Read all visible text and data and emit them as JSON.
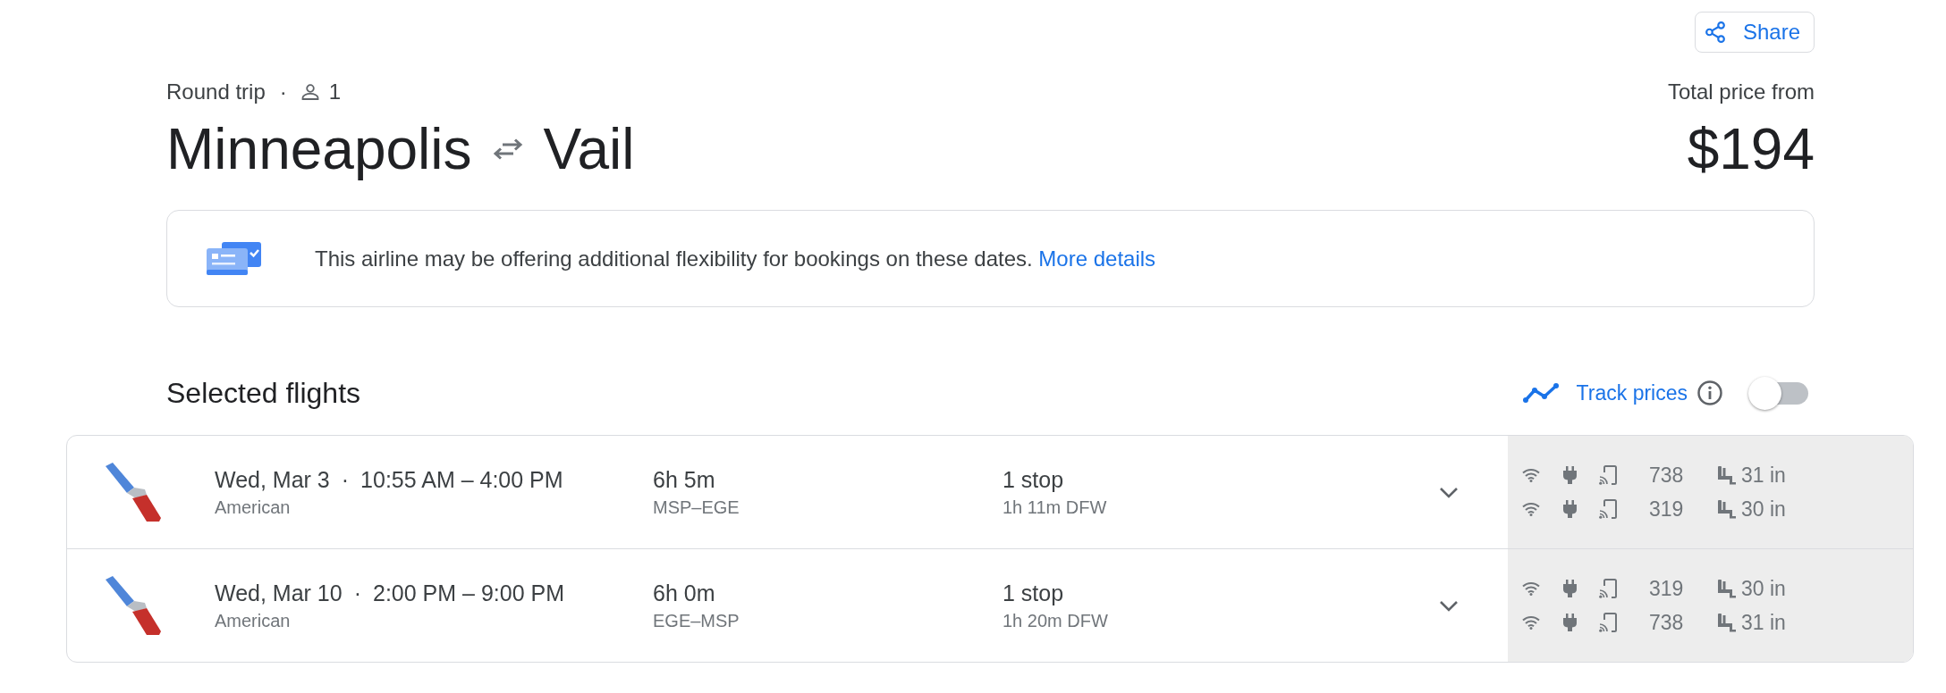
{
  "share": {
    "label": "Share"
  },
  "trip": {
    "type": "Round trip",
    "separator": "·",
    "passengers": "1",
    "origin": "Minneapolis",
    "destination": "Vail"
  },
  "price": {
    "label": "Total price from",
    "amount": "$194"
  },
  "notice": {
    "text": "This airline may be offering additional flexibility for bookings on these dates.",
    "link": "More details"
  },
  "selected_flights": {
    "title": "Selected flights",
    "track_prices": {
      "label": "Track prices",
      "on": false
    }
  },
  "flights": [
    {
      "date": "Wed, Mar 3",
      "separator": "·",
      "times": "10:55 AM – 4:00 PM",
      "airline": "American",
      "duration": "6h 5m",
      "route": "MSP–EGE",
      "stops": "1 stop",
      "layover": "1h 11m DFW",
      "expanded": false,
      "legs": [
        {
          "aircraft": "738",
          "legroom": "31 in"
        },
        {
          "aircraft": "319",
          "legroom": "30 in"
        }
      ]
    },
    {
      "date": "Wed, Mar 10",
      "separator": "·",
      "times": "2:00 PM – 9:00 PM",
      "airline": "American",
      "duration": "6h 0m",
      "route": "EGE–MSP",
      "stops": "1 stop",
      "layover": "1h 20m DFW",
      "expanded": false,
      "legs": [
        {
          "aircraft": "319",
          "legroom": "30 in"
        },
        {
          "aircraft": "738",
          "legroom": "31 in"
        }
      ]
    }
  ]
}
